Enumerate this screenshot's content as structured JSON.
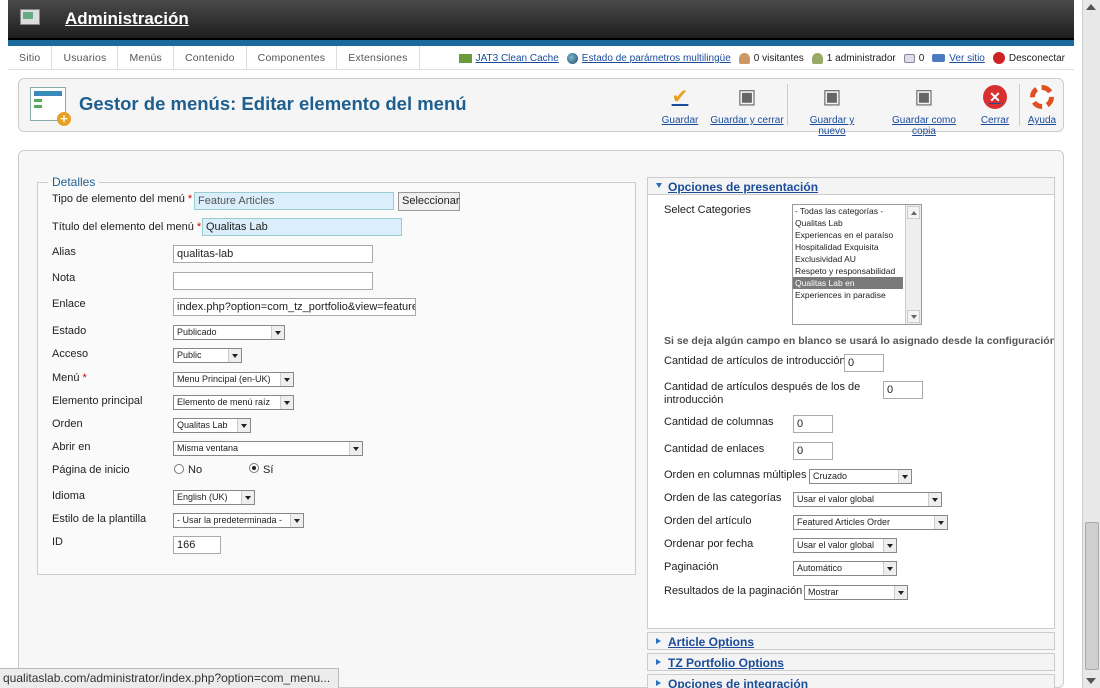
{
  "header": {
    "title": "Administración"
  },
  "menubar": {
    "items": [
      "Sitio",
      "Usuarios",
      "Menús",
      "Contenido",
      "Componentes",
      "Extensiones"
    ],
    "status": {
      "jat3": "JAT3 Clean Cache",
      "multilang": "Estado de parámetros multilingüe",
      "visitors": "0 visitantes",
      "admins": "1 administrador",
      "messages": "0",
      "view_site": "Ver sitio",
      "logout": "Desconectar"
    }
  },
  "toolbar": {
    "title": "Gestor de menús: Editar elemento del menú",
    "save": "Guardar",
    "save_close": "Guardar y cerrar",
    "save_new": "Guardar y nuevo",
    "save_copy": "Guardar como copia",
    "close": "Cerrar",
    "help": "Ayuda"
  },
  "details": {
    "legend": "Detalles",
    "type_label": "Tipo de elemento del menú",
    "type_value": "Feature Articles",
    "select_button": "Seleccionar",
    "title_label": "Título del elemento del menú",
    "title_value": "Qualitas Lab",
    "alias_label": "Alias",
    "alias_value": "qualitas-lab",
    "note_label": "Nota",
    "note_value": "",
    "link_label": "Enlace",
    "link_value": "index.php?option=com_tz_portfolio&view=featured",
    "status_label": "Estado",
    "status_value": "Publicado",
    "access_label": "Acceso",
    "access_value": "Public",
    "menu_label": "Menú",
    "menu_value": "Menu Principal (en-UK)",
    "parent_label": "Elemento principal",
    "parent_value": "Elemento de menú raíz",
    "order_label": "Orden",
    "order_value": "Qualitas Lab",
    "open_label": "Abrir en",
    "open_value": "Misma ventana",
    "home_label": "Página de inicio",
    "home_no": "No",
    "home_yes": "Sí",
    "lang_label": "Idioma",
    "lang_value": "English (UK)",
    "style_label": "Estilo de la plantilla",
    "style_value": "- Usar la predeterminada -",
    "id_label": "ID",
    "id_value": "166"
  },
  "presentation": {
    "header": "Opciones de presentación",
    "categories_label": "Select Categories",
    "categories": [
      "- Todas las categorías -",
      "Qualitas Lab",
      "Experiencas en el paraíso",
      "Hospitalidad Exquisita",
      "Exclusividad AU",
      "Respeto y responsabilidad",
      "Qualitas Lab en",
      "Experiences in paradise"
    ],
    "selected_index": 6,
    "note": "Si se deja algún campo en blanco se usará lo asignado desde la configuración gl",
    "intro_label": "Cantidad de artículos de introducción",
    "intro_value": "0",
    "after_label": "Cantidad de artículos después de los de introducción",
    "after_value": "0",
    "columns_label": "Cantidad de columnas",
    "columns_value": "0",
    "links_label": "Cantidad de enlaces",
    "links_value": "0",
    "multicol_label": "Orden en columnas múltiples",
    "multicol_value": "Cruzado",
    "cat_order_label": "Orden de las categorías",
    "cat_order_value": "Usar el valor global",
    "article_order_label": "Orden del artículo",
    "article_order_value": "Featured Articles Order",
    "date_order_label": "Ordenar por fecha",
    "date_order_value": "Usar el valor global",
    "pagination_label": "Paginación",
    "pagination_value": "Automático",
    "pag_results_label": "Resultados de la paginación",
    "pag_results_value": "Mostrar"
  },
  "panels": {
    "article": "Article Options",
    "tz": "TZ Portfolio Options",
    "integration": "Opciones de integración"
  },
  "statusbar": {
    "url": "qualitaslab.com/administrator/index.php?option=com_menu..."
  },
  "colors": {
    "accent": "#1f5f8f",
    "link": "#1a4c9a",
    "header_bg": "#2a2a2a",
    "blue_strip": "#1b6a9c"
  }
}
